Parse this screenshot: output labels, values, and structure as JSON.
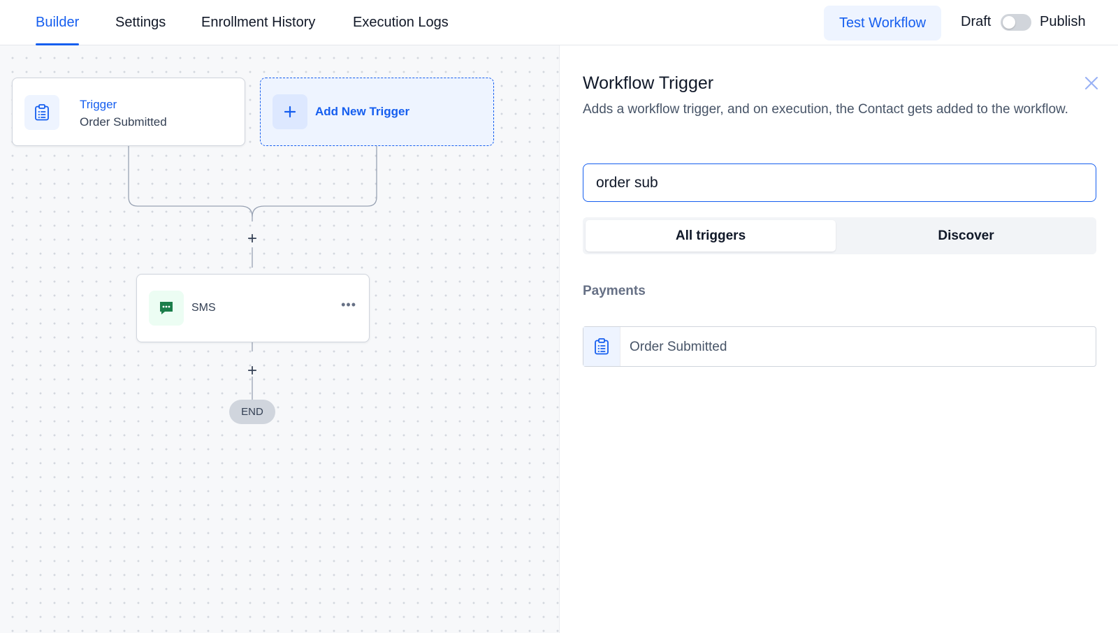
{
  "tabs": [
    {
      "label": "Builder",
      "active": true
    },
    {
      "label": "Settings",
      "active": false
    },
    {
      "label": "Enrollment History",
      "active": false
    },
    {
      "label": "Execution Logs",
      "active": false
    }
  ],
  "header": {
    "test_button": "Test Workflow",
    "draft_label": "Draft",
    "publish_label": "Publish",
    "publish_toggle_on": false
  },
  "canvas": {
    "trigger_node": {
      "title": "Trigger",
      "subtitle": "Order Submitted",
      "icon": "clipboard-icon"
    },
    "add_trigger": {
      "label": "Add New Trigger",
      "icon": "plus-icon"
    },
    "add_step_symbol": "+",
    "sms_node": {
      "label": "SMS",
      "icon": "message-icon",
      "menu": "•••"
    },
    "end_label": "END"
  },
  "panel": {
    "title": "Workflow Trigger",
    "description": "Adds a workflow trigger, and on execution, the Contact gets added to the workflow.",
    "search_value": "order sub",
    "segments": [
      {
        "label": "All triggers",
        "active": true
      },
      {
        "label": "Discover",
        "active": false
      }
    ],
    "category": "Payments",
    "results": [
      {
        "label": "Order Submitted",
        "icon": "clipboard-icon"
      }
    ]
  },
  "colors": {
    "accent": "#155eef",
    "accent_light": "#eef4ff",
    "sms_green": "#1b7d4a",
    "canvas_bg": "#f7f8fa"
  }
}
